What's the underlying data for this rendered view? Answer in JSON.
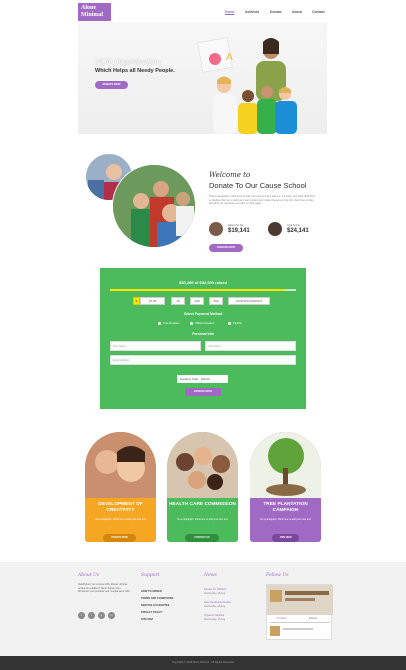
{
  "header": {
    "logo": "Alone Minimal",
    "nav": [
      "Home",
      "Activists",
      "Donate",
      "About",
      "Contact"
    ]
  },
  "hero": {
    "title_line1": "NGO Organization",
    "title_line2": "Which Helps all Needy People.",
    "button": "DONATE NOW"
  },
  "welcome": {
    "title_italic": "Welcome to",
    "title_main": "Donate To Our Cause School",
    "paragraph": "This is paragraph. Click here to add your own text and edit me. It's easy. Just click \"Edit Text\" or double click me to add your own content and make changes to the font. Feel free to drag and drop me anywhere you like on your page.",
    "stats": [
      {
        "label": "Raised So Far",
        "value": "$19,141"
      },
      {
        "label": "Goal So Far",
        "value": "$24,141"
      }
    ],
    "button": "DONATE NOW"
  },
  "donation": {
    "raised_text": "$30,280 of $32,000 raised",
    "progress_fraction": 0.946,
    "currency": "$",
    "amounts": [
      "10.00",
      "15",
      "100",
      "200",
      "500",
      "CUSTOM AMOUNT"
    ],
    "payment_heading": "Select Payment Method",
    "payment_methods": [
      "Test Donation",
      "Offline Donation",
      "PayPal"
    ],
    "personal_heading": "Personal Info",
    "fields": {
      "first_name": "First Name",
      "last_name": "Last Name",
      "email": "Email Address"
    },
    "recurring_label": "Donation Total:",
    "recurring_value": "$10.00",
    "button": "DONATE NOW"
  },
  "cards": [
    {
      "title": "DEVELOPMENT OF CREATIVITY",
      "text": "I'm a paragraph. Click here to add your own text.",
      "button": "DONATE NOW",
      "color": "#f5a623",
      "btn_color": "#d4860a"
    },
    {
      "title": "HEALTH CARE COMMISSION",
      "text": "I'm a paragraph. Click here to add your own text.",
      "button": "CONTACT US",
      "color": "#4cbb5c",
      "btn_color": "#2f8f3d"
    },
    {
      "title": "TREE PLANTATION CAMPAIGN",
      "text": "I'm a paragraph. Click here to add your own text.",
      "button": "JOIN NOW",
      "color": "#a06ac4",
      "btn_color": "#7b469e"
    }
  ],
  "footer": {
    "about_heading": "About Us",
    "about_text": "Vestibulum nec cursus nibh. Donec ultrices ornare leo eleifend. Nunc donec arcu fermentum vel pulvinar sed, feugiat ante nibh.",
    "support_heading": "Support",
    "support_links": [
      "HOW TO ORDER",
      "TERMS AND CONDITIONS",
      "SERVICE GUARANTEE",
      "PRIVACY POLICY",
      "SITE MAP"
    ],
    "news_heading": "News",
    "news": [
      {
        "title": "Donate for Children",
        "date": "Wednesday, 15 Aug"
      },
      {
        "title": "Help the Needy People",
        "date": "Wednesday, 15 Aug"
      },
      {
        "title": "Organize Medical",
        "date": "Wednesday, 15 Aug"
      }
    ],
    "follow_heading": "Follow Us",
    "widget_tabs": [
      "Timeline",
      "Events"
    ],
    "copyright": "Copyright © 2016 Alone Minimal · All Rights Reserved",
    "colors": {
      "accent": "#a06ac4",
      "green": "#4cbb5c",
      "orange": "#f5a623"
    }
  }
}
